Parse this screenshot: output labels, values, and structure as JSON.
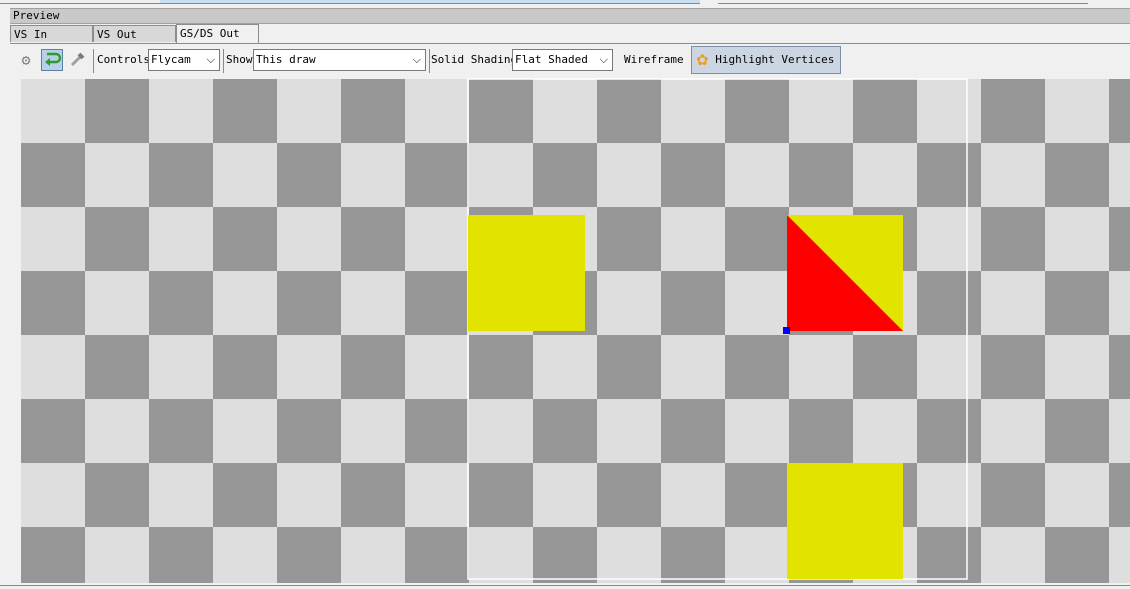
{
  "panel": {
    "title": "Preview"
  },
  "tabs": [
    {
      "label": "VS In"
    },
    {
      "label": "VS Out"
    },
    {
      "label": "GS/DS Out",
      "active": true
    }
  ],
  "toolbar": {
    "icons": {
      "settings": "gear-icon",
      "flip_y": "flip-arrow-icon",
      "pick": "dropper-icon"
    },
    "controls_label": "Controls",
    "controls_value": "Flycam",
    "show_label": "Show",
    "show_value": "This draw",
    "solid_label": "Solid Shading",
    "solid_value": "Flat Shaded",
    "wireframe_label": "Wireframe",
    "highlight_label": "Highlight Vertices",
    "highlight_icon": "flower-icon"
  },
  "viewport": {
    "checker_colors": {
      "dark": "#969696",
      "light": "#dedede"
    },
    "frustum_color": "#ffffff",
    "shapes": [
      {
        "name": "quad-top-left",
        "color": "#e3e300"
      },
      {
        "name": "quad-top-right",
        "color": "#e3e300",
        "triangle_color": "#ff0000"
      },
      {
        "name": "quad-bottom",
        "color": "#e3e300"
      }
    ],
    "vertex_highlight_color": "#0000ff"
  }
}
